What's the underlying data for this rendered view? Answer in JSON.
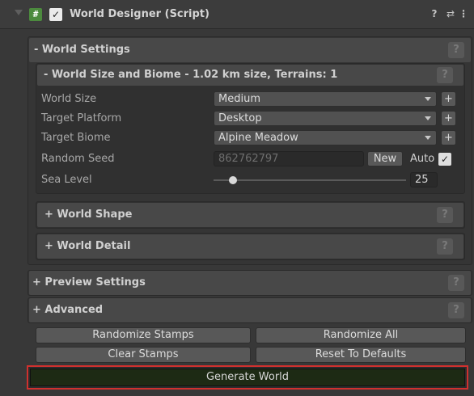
{
  "component": {
    "title": "World Designer (Script)",
    "script_icon": "#",
    "enabled_check": "✓",
    "help_icon": "?",
    "preset_icon": "⇄",
    "menu_icon": "⋮"
  },
  "world_settings": {
    "title": "- World Settings",
    "help": "?",
    "size_biome": {
      "title": "-  World Size and Biome - 1.02 km size, Terrains: 1",
      "help": "?",
      "fields": [
        {
          "label": "World Size",
          "value": "Medium",
          "plus": "+"
        },
        {
          "label": "Target Platform",
          "value": "Desktop",
          "plus": "+"
        },
        {
          "label": "Target Biome",
          "value": "Alpine Meadow",
          "plus": "+"
        }
      ],
      "seed": {
        "label": "Random Seed",
        "value": "862762797",
        "new_label": "New",
        "auto_label": "Auto",
        "auto_check": "✓"
      },
      "sea_level": {
        "label": "Sea Level",
        "value": "25",
        "slider_fraction": 0.1
      }
    },
    "world_shape": {
      "title": "+  World Shape",
      "help": "?"
    },
    "world_detail": {
      "title": "+  World Detail",
      "help": "?"
    }
  },
  "preview_settings": {
    "title": "+ Preview Settings",
    "help": "?"
  },
  "advanced": {
    "title": "+ Advanced",
    "help": "?",
    "buttons": {
      "randomize_stamps": "Randomize Stamps",
      "randomize_all": "Randomize All",
      "clear_stamps": "Clear Stamps",
      "reset_defaults": "Reset To Defaults"
    }
  },
  "generate": {
    "label": "Generate World"
  },
  "colors": {
    "background": "#383838",
    "generate_button": "#1d2a14",
    "highlight_border": "#d0302e",
    "script_icon": "#4c8a3e"
  }
}
